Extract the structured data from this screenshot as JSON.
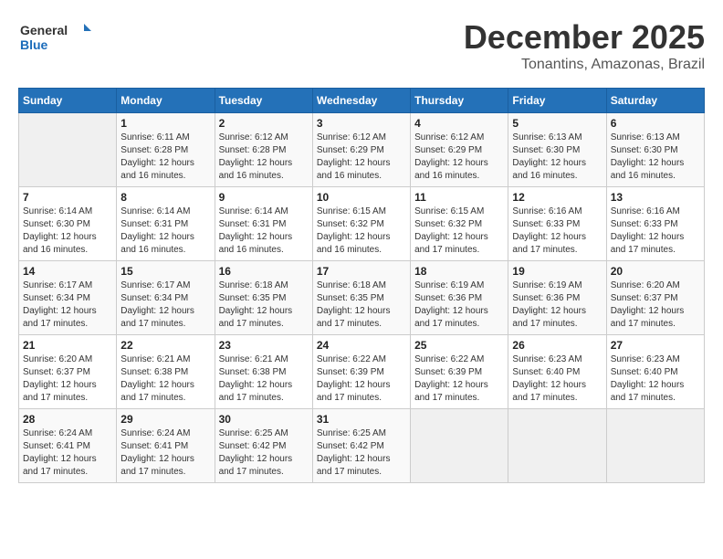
{
  "logo": {
    "line1": "General",
    "line2": "Blue"
  },
  "title": "December 2025",
  "subtitle": "Tonantins, Amazonas, Brazil",
  "days_of_week": [
    "Sunday",
    "Monday",
    "Tuesday",
    "Wednesday",
    "Thursday",
    "Friday",
    "Saturday"
  ],
  "weeks": [
    [
      {
        "day": "",
        "sunrise": "",
        "sunset": "",
        "daylight": ""
      },
      {
        "day": "1",
        "sunrise": "Sunrise: 6:11 AM",
        "sunset": "Sunset: 6:28 PM",
        "daylight": "Daylight: 12 hours and 16 minutes."
      },
      {
        "day": "2",
        "sunrise": "Sunrise: 6:12 AM",
        "sunset": "Sunset: 6:28 PM",
        "daylight": "Daylight: 12 hours and 16 minutes."
      },
      {
        "day": "3",
        "sunrise": "Sunrise: 6:12 AM",
        "sunset": "Sunset: 6:29 PM",
        "daylight": "Daylight: 12 hours and 16 minutes."
      },
      {
        "day": "4",
        "sunrise": "Sunrise: 6:12 AM",
        "sunset": "Sunset: 6:29 PM",
        "daylight": "Daylight: 12 hours and 16 minutes."
      },
      {
        "day": "5",
        "sunrise": "Sunrise: 6:13 AM",
        "sunset": "Sunset: 6:30 PM",
        "daylight": "Daylight: 12 hours and 16 minutes."
      },
      {
        "day": "6",
        "sunrise": "Sunrise: 6:13 AM",
        "sunset": "Sunset: 6:30 PM",
        "daylight": "Daylight: 12 hours and 16 minutes."
      }
    ],
    [
      {
        "day": "7",
        "sunrise": "Sunrise: 6:14 AM",
        "sunset": "Sunset: 6:30 PM",
        "daylight": "Daylight: 12 hours and 16 minutes."
      },
      {
        "day": "8",
        "sunrise": "Sunrise: 6:14 AM",
        "sunset": "Sunset: 6:31 PM",
        "daylight": "Daylight: 12 hours and 16 minutes."
      },
      {
        "day": "9",
        "sunrise": "Sunrise: 6:14 AM",
        "sunset": "Sunset: 6:31 PM",
        "daylight": "Daylight: 12 hours and 16 minutes."
      },
      {
        "day": "10",
        "sunrise": "Sunrise: 6:15 AM",
        "sunset": "Sunset: 6:32 PM",
        "daylight": "Daylight: 12 hours and 16 minutes."
      },
      {
        "day": "11",
        "sunrise": "Sunrise: 6:15 AM",
        "sunset": "Sunset: 6:32 PM",
        "daylight": "Daylight: 12 hours and 17 minutes."
      },
      {
        "day": "12",
        "sunrise": "Sunrise: 6:16 AM",
        "sunset": "Sunset: 6:33 PM",
        "daylight": "Daylight: 12 hours and 17 minutes."
      },
      {
        "day": "13",
        "sunrise": "Sunrise: 6:16 AM",
        "sunset": "Sunset: 6:33 PM",
        "daylight": "Daylight: 12 hours and 17 minutes."
      }
    ],
    [
      {
        "day": "14",
        "sunrise": "Sunrise: 6:17 AM",
        "sunset": "Sunset: 6:34 PM",
        "daylight": "Daylight: 12 hours and 17 minutes."
      },
      {
        "day": "15",
        "sunrise": "Sunrise: 6:17 AM",
        "sunset": "Sunset: 6:34 PM",
        "daylight": "Daylight: 12 hours and 17 minutes."
      },
      {
        "day": "16",
        "sunrise": "Sunrise: 6:18 AM",
        "sunset": "Sunset: 6:35 PM",
        "daylight": "Daylight: 12 hours and 17 minutes."
      },
      {
        "day": "17",
        "sunrise": "Sunrise: 6:18 AM",
        "sunset": "Sunset: 6:35 PM",
        "daylight": "Daylight: 12 hours and 17 minutes."
      },
      {
        "day": "18",
        "sunrise": "Sunrise: 6:19 AM",
        "sunset": "Sunset: 6:36 PM",
        "daylight": "Daylight: 12 hours and 17 minutes."
      },
      {
        "day": "19",
        "sunrise": "Sunrise: 6:19 AM",
        "sunset": "Sunset: 6:36 PM",
        "daylight": "Daylight: 12 hours and 17 minutes."
      },
      {
        "day": "20",
        "sunrise": "Sunrise: 6:20 AM",
        "sunset": "Sunset: 6:37 PM",
        "daylight": "Daylight: 12 hours and 17 minutes."
      }
    ],
    [
      {
        "day": "21",
        "sunrise": "Sunrise: 6:20 AM",
        "sunset": "Sunset: 6:37 PM",
        "daylight": "Daylight: 12 hours and 17 minutes."
      },
      {
        "day": "22",
        "sunrise": "Sunrise: 6:21 AM",
        "sunset": "Sunset: 6:38 PM",
        "daylight": "Daylight: 12 hours and 17 minutes."
      },
      {
        "day": "23",
        "sunrise": "Sunrise: 6:21 AM",
        "sunset": "Sunset: 6:38 PM",
        "daylight": "Daylight: 12 hours and 17 minutes."
      },
      {
        "day": "24",
        "sunrise": "Sunrise: 6:22 AM",
        "sunset": "Sunset: 6:39 PM",
        "daylight": "Daylight: 12 hours and 17 minutes."
      },
      {
        "day": "25",
        "sunrise": "Sunrise: 6:22 AM",
        "sunset": "Sunset: 6:39 PM",
        "daylight": "Daylight: 12 hours and 17 minutes."
      },
      {
        "day": "26",
        "sunrise": "Sunrise: 6:23 AM",
        "sunset": "Sunset: 6:40 PM",
        "daylight": "Daylight: 12 hours and 17 minutes."
      },
      {
        "day": "27",
        "sunrise": "Sunrise: 6:23 AM",
        "sunset": "Sunset: 6:40 PM",
        "daylight": "Daylight: 12 hours and 17 minutes."
      }
    ],
    [
      {
        "day": "28",
        "sunrise": "Sunrise: 6:24 AM",
        "sunset": "Sunset: 6:41 PM",
        "daylight": "Daylight: 12 hours and 17 minutes."
      },
      {
        "day": "29",
        "sunrise": "Sunrise: 6:24 AM",
        "sunset": "Sunset: 6:41 PM",
        "daylight": "Daylight: 12 hours and 17 minutes."
      },
      {
        "day": "30",
        "sunrise": "Sunrise: 6:25 AM",
        "sunset": "Sunset: 6:42 PM",
        "daylight": "Daylight: 12 hours and 17 minutes."
      },
      {
        "day": "31",
        "sunrise": "Sunrise: 6:25 AM",
        "sunset": "Sunset: 6:42 PM",
        "daylight": "Daylight: 12 hours and 17 minutes."
      },
      {
        "day": "",
        "sunrise": "",
        "sunset": "",
        "daylight": ""
      },
      {
        "day": "",
        "sunrise": "",
        "sunset": "",
        "daylight": ""
      },
      {
        "day": "",
        "sunrise": "",
        "sunset": "",
        "daylight": ""
      }
    ]
  ]
}
